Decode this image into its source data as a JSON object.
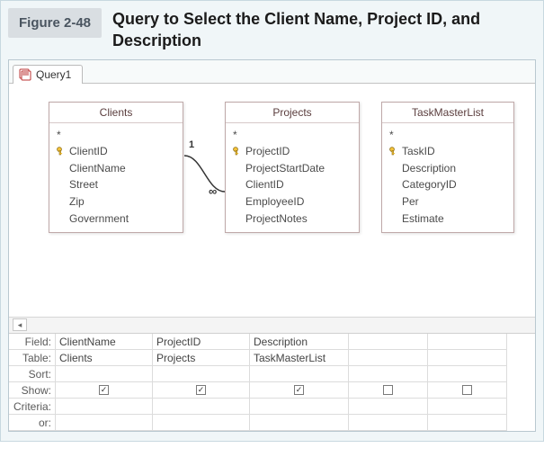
{
  "figure": {
    "tag": "Figure 2-48",
    "title": "Query to Select the Client Name, Project ID, and Description"
  },
  "tab": {
    "label": "Query1"
  },
  "tables": {
    "clients": {
      "title": "Clients",
      "star": "*",
      "keyField": "ClientID",
      "fields": [
        "ClientName",
        "Street",
        "Zip",
        "Government"
      ]
    },
    "projects": {
      "title": "Projects",
      "star": "*",
      "keyField": "ProjectID",
      "fields": [
        "ProjectStartDate",
        "ClientID",
        "EmployeeID",
        "ProjectNotes"
      ]
    },
    "taskmaster": {
      "title": "TaskMasterList",
      "star": "*",
      "keyField": "TaskID",
      "fields": [
        "Description",
        "CategoryID",
        "Per",
        "Estimate"
      ]
    }
  },
  "relationship": {
    "oneLabel": "1",
    "manyLabel": "∞"
  },
  "grid": {
    "rowLabels": {
      "field": "Field:",
      "table": "Table:",
      "sort": "Sort:",
      "show": "Show:",
      "criteria": "Criteria:",
      "or": "or:"
    },
    "columns": [
      {
        "field": "ClientName",
        "table": "Clients",
        "sort": "",
        "show": true,
        "criteria": "",
        "or": ""
      },
      {
        "field": "ProjectID",
        "table": "Projects",
        "sort": "",
        "show": true,
        "criteria": "",
        "or": ""
      },
      {
        "field": "Description",
        "table": "TaskMasterList",
        "sort": "",
        "show": true,
        "criteria": "",
        "or": ""
      },
      {
        "field": "",
        "table": "",
        "sort": "",
        "show": false,
        "criteria": "",
        "or": ""
      },
      {
        "field": "",
        "table": "",
        "sort": "",
        "show": false,
        "criteria": "",
        "or": ""
      }
    ]
  },
  "checkGlyph": "✓"
}
